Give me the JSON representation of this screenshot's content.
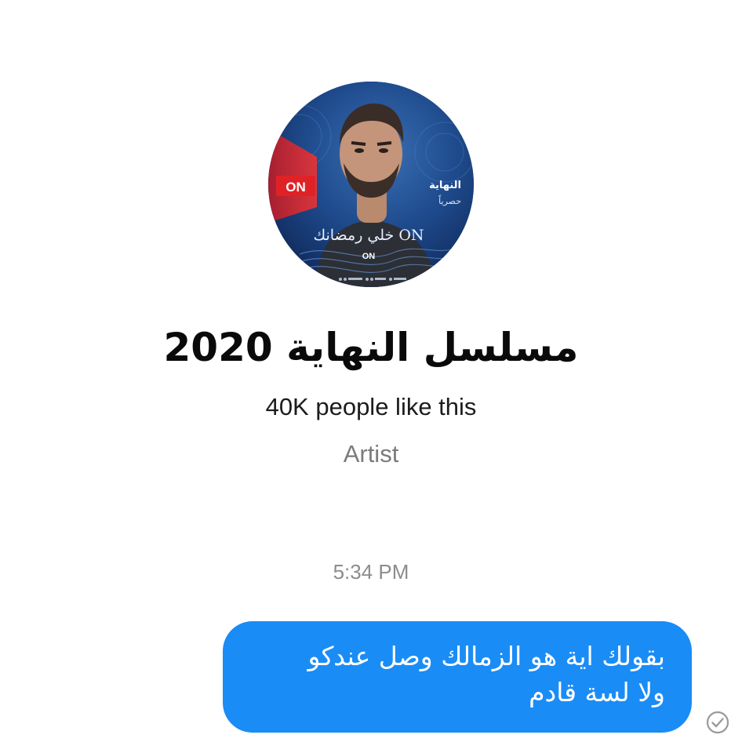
{
  "profile": {
    "image_badge_left": "ON",
    "image_badge_bottom": "ON",
    "image_title": "النهاية",
    "image_subtitle": "حصرياً",
    "image_logo_text": "خلي رمضانك ON"
  },
  "page": {
    "name": "مسلسل النهاية 2020",
    "likes": "40K people like this",
    "category": "Artist"
  },
  "conversation": {
    "timestamp": "5:34 PM",
    "messages": [
      {
        "direction": "outgoing",
        "lines": [
          "بقولك اية هو الزمالك وصل عندكو",
          "ولا لسة قادم"
        ],
        "status": "sent"
      }
    ]
  },
  "colors": {
    "bubble": "#1a8cf6",
    "bubble_text": "#ffffff",
    "secondary_text": "#8c8c8c",
    "status_icon": "#9a9a9a"
  },
  "icons": {
    "status": "sent-check-circle-icon"
  }
}
